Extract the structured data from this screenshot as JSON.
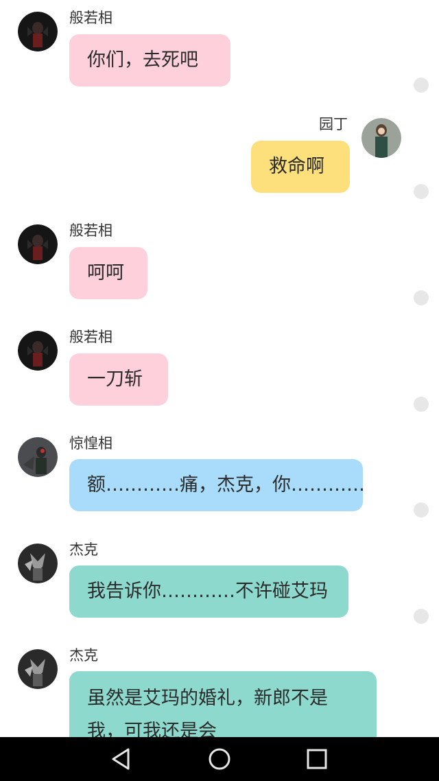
{
  "colors": {
    "pink_bubble": "#fdd0dc",
    "yellow_bubble": "#fde07b",
    "blue_bubble": "#a8dcfa",
    "teal_bubble": "#8ed9cd",
    "dot": "#e7e7e7",
    "navbar": "#000000"
  },
  "messages": [
    {
      "sender": "般若相",
      "text": "你们，去死吧",
      "side": "left",
      "avatar_icon": "hannya-avatar-icon"
    },
    {
      "sender": "园丁",
      "text": "救命啊",
      "side": "right",
      "avatar_icon": "gardener-avatar-icon"
    },
    {
      "sender": "般若相",
      "text": "呵呵",
      "side": "left",
      "avatar_icon": "hannya-avatar-icon"
    },
    {
      "sender": "般若相",
      "text": "一刀斩",
      "side": "left",
      "avatar_icon": "hannya-avatar-icon"
    },
    {
      "sender": "惊惶相",
      "text": "额…………痛，杰克，你…………",
      "side": "left",
      "avatar_icon": "panic-avatar-icon"
    },
    {
      "sender": "杰克",
      "text": "我告诉你…………不许碰艾玛",
      "side": "left",
      "avatar_icon": "jack-avatar-icon"
    },
    {
      "sender": "杰克",
      "text": "虽然是艾玛的婚礼，新郎不是我，可我还是会",
      "side": "left",
      "avatar_icon": "jack-avatar-icon"
    }
  ],
  "navbar": {
    "icons": [
      "back-triangle-icon",
      "home-circle-icon",
      "recents-square-icon"
    ]
  }
}
